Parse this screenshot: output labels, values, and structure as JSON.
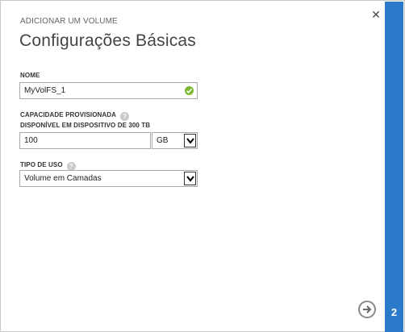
{
  "dialog": {
    "eyebrow": "ADICIONAR UM VOLUME",
    "title": "Configurações Básicas",
    "step_number": "2"
  },
  "name_field": {
    "label": "NOME",
    "value": "MyVolFS_1",
    "status_icon": "check-icon"
  },
  "capacity": {
    "label": "CAPACIDADE PROVISIONADA",
    "sublabel": "DISPONÍVEL EM DISPOSITIVO DE 300 TB",
    "value": "100",
    "unit_selected": "GB"
  },
  "usage_type": {
    "label": "TIPO DE USO",
    "selected": "Volume em Camadas"
  },
  "colors": {
    "accent_strip": "#2b79c9",
    "valid_green": "#7ab830",
    "help_gray": "#c9c9c9"
  }
}
